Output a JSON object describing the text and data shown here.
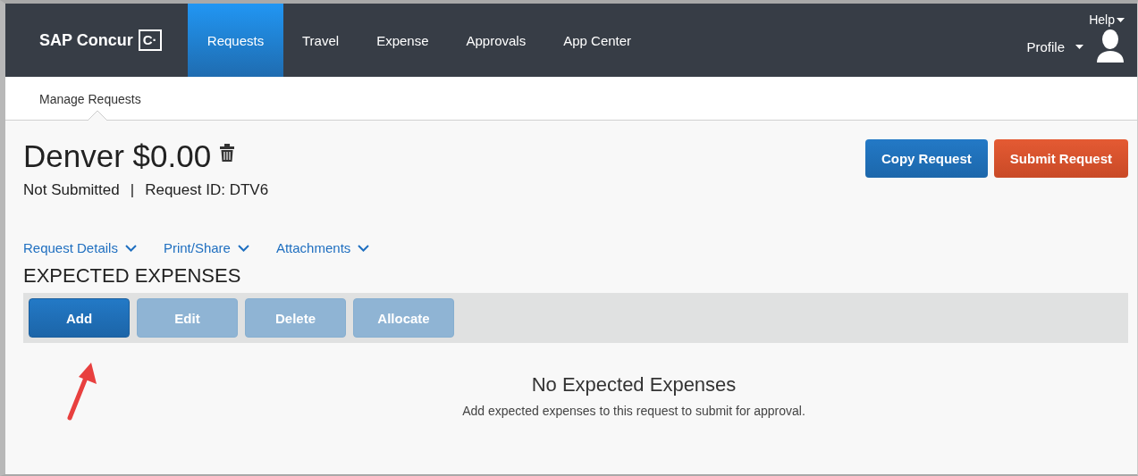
{
  "brand": {
    "name": "SAP Concur",
    "mark": "C·"
  },
  "nav": [
    {
      "label": "Requests",
      "selected": true
    },
    {
      "label": "Travel",
      "selected": false
    },
    {
      "label": "Expense",
      "selected": false
    },
    {
      "label": "Approvals",
      "selected": false
    },
    {
      "label": "App Center",
      "selected": false
    }
  ],
  "help": "Help",
  "profile": "Profile",
  "subnav": [
    {
      "label": "Manage Requests"
    }
  ],
  "request": {
    "title": "Denver $0.00",
    "status": "Not Submitted",
    "separator": "|",
    "id": "Request ID: DTV6"
  },
  "actions": [
    {
      "label": "Copy Request",
      "kind": "primary"
    },
    {
      "label": "Submit Request",
      "kind": "submit"
    }
  ],
  "menus": [
    {
      "label": "Request Details"
    },
    {
      "label": "Print/Share"
    },
    {
      "label": "Attachments"
    }
  ],
  "section_title": "EXPECTED EXPENSES",
  "toolbar": [
    {
      "label": "Add",
      "disabled": false
    },
    {
      "label": "Edit",
      "disabled": true
    },
    {
      "label": "Delete",
      "disabled": true
    },
    {
      "label": "Allocate",
      "disabled": true
    }
  ],
  "empty": {
    "title": "No Expected Expenses",
    "message": "Add expected expenses to this request to submit for approval."
  }
}
